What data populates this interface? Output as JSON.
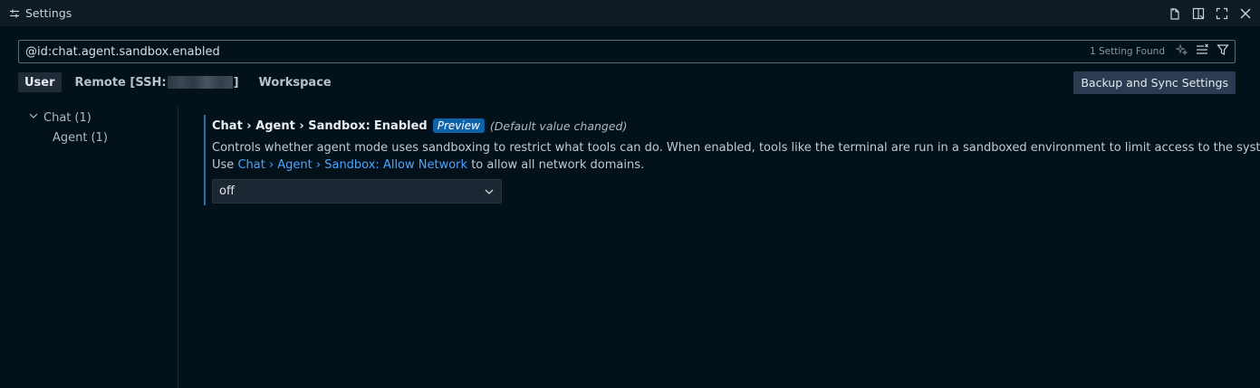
{
  "tab": {
    "title": "Settings",
    "icon": "settings-sliders-icon"
  },
  "tab_actions": [
    {
      "name": "open-settings-json-icon"
    },
    {
      "name": "split-editor-icon"
    },
    {
      "name": "maximize-icon"
    },
    {
      "name": "close-icon"
    }
  ],
  "search": {
    "value": "@id:chat.agent.sandbox.enabled",
    "result_count": "1 Setting Found",
    "icons": [
      "ai-search-icon",
      "clear-filter-icon",
      "filter-icon"
    ]
  },
  "scopes": {
    "user": "User",
    "remote_prefix": "Remote [SSH:",
    "remote_suffix": "]",
    "workspace": "Workspace"
  },
  "sync_button": "Backup and Sync Settings",
  "toc": {
    "chat": "Chat",
    "chat_count": "(1)",
    "agent": "Agent",
    "agent_count": "(1)"
  },
  "setting": {
    "title_prefix": "Chat › Agent › Sandbox:",
    "title_name": "Enabled",
    "badge": "Preview",
    "modified_note": "(Default value changed)",
    "description_line1": "Controls whether agent mode uses sandboxing to restrict what tools can do. When enabled, tools like the terminal are run in a sandboxed environment to limit access to the system.",
    "description_line2_prefix": "Use",
    "description_link": "Chat › Agent › Sandbox: Allow Network",
    "description_line2_suffix": "to allow all network domains.",
    "value": "off"
  },
  "colors": {
    "background": "#03111b",
    "accent_link": "#4da3ff",
    "badge_bg": "#0e62a8",
    "modified_border": "#2d6fa8"
  }
}
